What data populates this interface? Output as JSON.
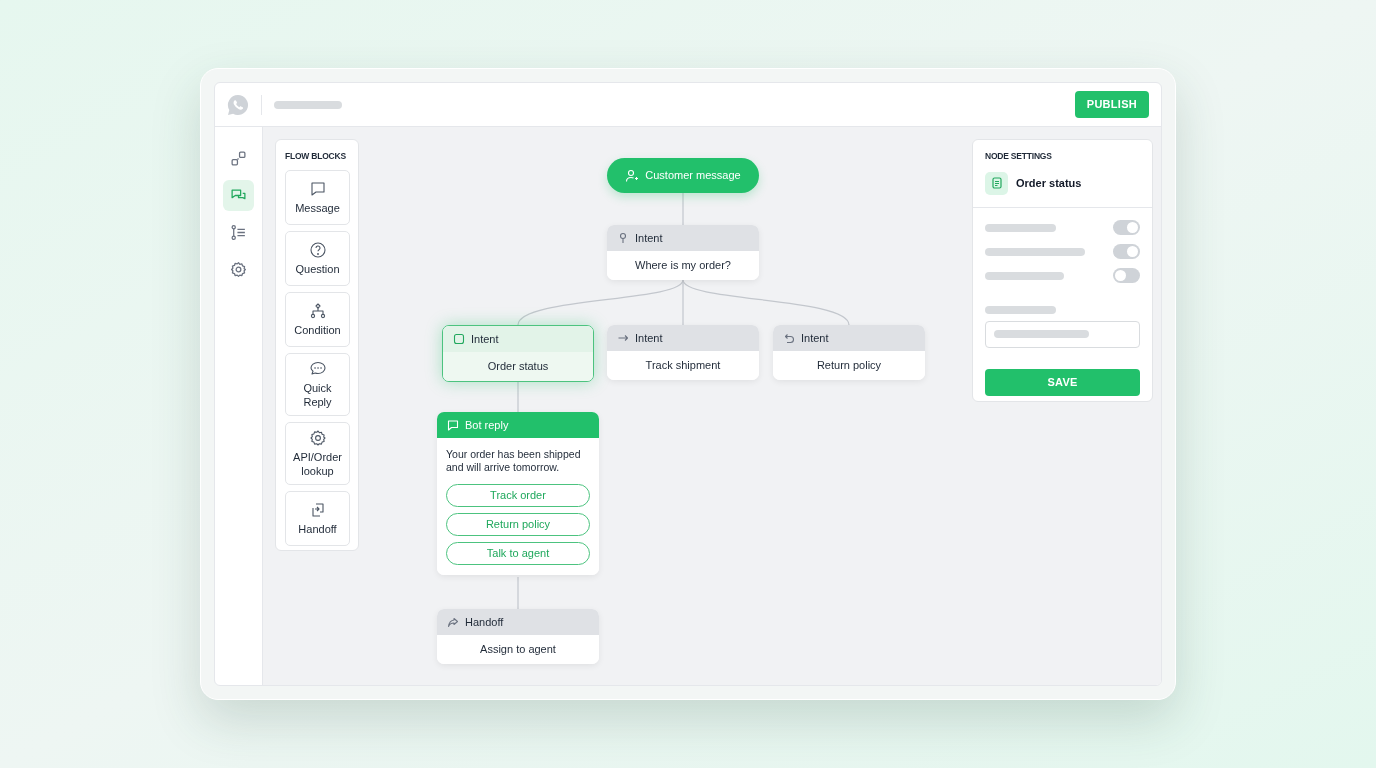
{
  "top_bar": {
    "publish_button": "PUBLISH"
  },
  "rail": [
    {
      "selected": false
    },
    {
      "selected": true
    },
    {
      "selected": false
    },
    {
      "selected": false
    }
  ],
  "flow_blocks": {
    "title": "FLOW BLOCKS",
    "items": [
      "Message",
      "Question",
      "Condition",
      "Quick Reply",
      "API/Order lookup",
      "Handoff"
    ]
  },
  "canvas": {
    "trigger": {
      "label": "Customer message"
    },
    "root_intent": {
      "title": "Intent",
      "text": "Where is my order?"
    },
    "branches": [
      {
        "title": "Intent",
        "text": "Order status",
        "selected": true
      },
      {
        "title": "Intent",
        "text": "Track shipment",
        "selected": false
      },
      {
        "title": "Intent",
        "text": "Return policy",
        "selected": false
      }
    ],
    "bot_reply": {
      "title": "Bot reply",
      "text": "Your order has been shipped and will arrive tomorrow.",
      "quick_replies": [
        "Track order",
        "Return policy",
        "Talk to agent"
      ]
    },
    "handoff": {
      "title": "Handoff",
      "text": "Assign to agent"
    }
  },
  "node_settings": {
    "title": "NODE SETTINGS",
    "node_name": "Order status",
    "toggles": [
      {
        "on": true
      },
      {
        "on": true
      },
      {
        "on": false
      }
    ],
    "save_button": "SAVE"
  }
}
